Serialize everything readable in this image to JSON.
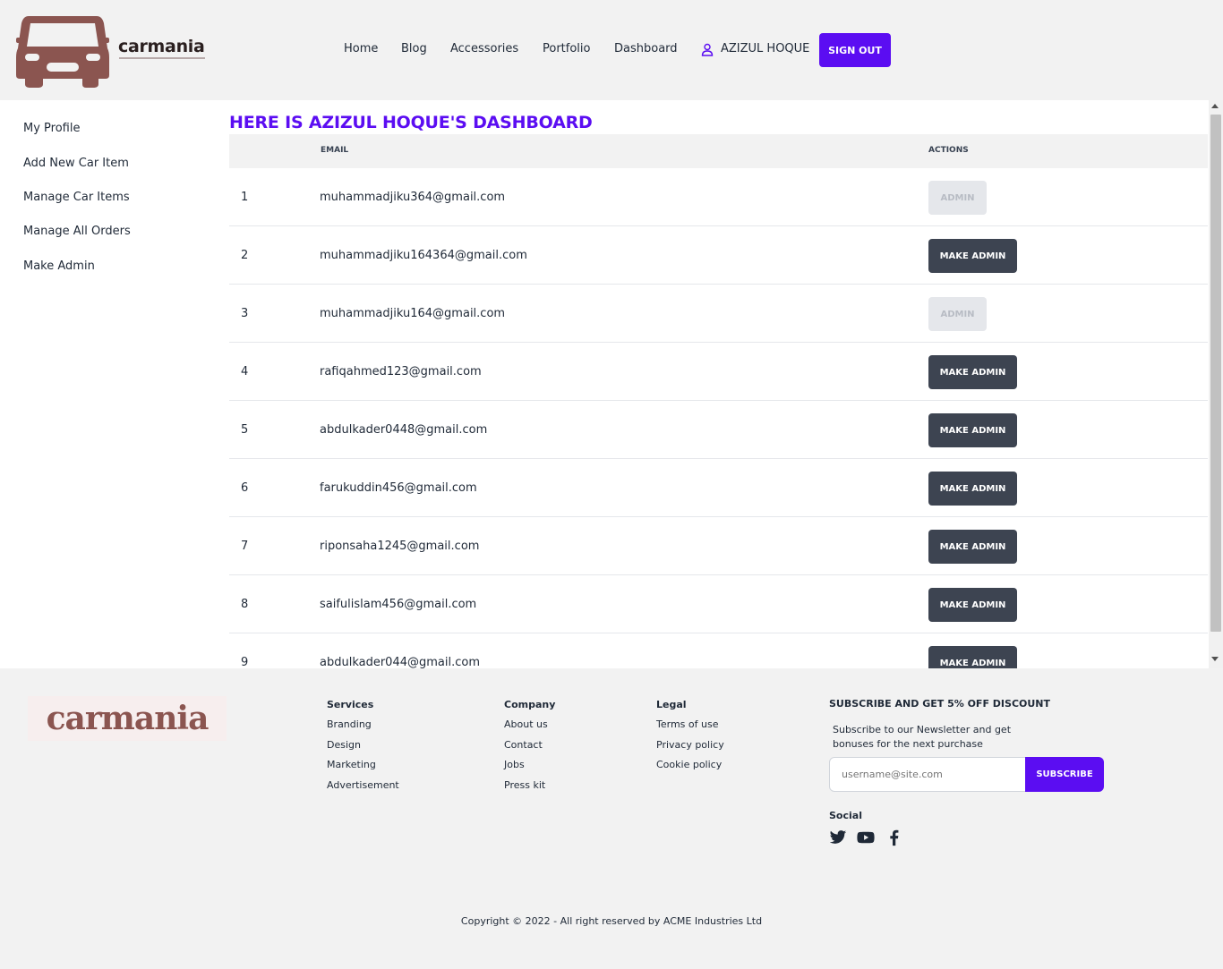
{
  "brand": {
    "name": "carmania",
    "accent": "#5b0df2",
    "logo_color": "#8b5550"
  },
  "nav": {
    "items": [
      "Home",
      "Blog",
      "Accessories",
      "Portfolio",
      "Dashboard"
    ],
    "user_name": "AZIZUL HOQUE",
    "signout_label": "SIGN OUT"
  },
  "sidebar": {
    "items": [
      "My Profile",
      "Add New Car Item",
      "Manage Car Items",
      "Manage All Orders",
      "Make Admin"
    ]
  },
  "dashboard": {
    "title": "HERE IS AZIZUL HOQUE'S DASHBOARD",
    "columns": [
      "EMAIL",
      "ACTIONS"
    ],
    "rows": [
      {
        "num": "1",
        "email": "muhammadjiku364@gmail.com",
        "action": "ADMIN",
        "is_admin": true
      },
      {
        "num": "2",
        "email": "muhammadjiku164364@gmail.com",
        "action": "MAKE ADMIN",
        "is_admin": false
      },
      {
        "num": "3",
        "email": "muhammadjiku164@gmail.com",
        "action": "ADMIN",
        "is_admin": true
      },
      {
        "num": "4",
        "email": "rafiqahmed123@gmail.com",
        "action": "MAKE ADMIN",
        "is_admin": false
      },
      {
        "num": "5",
        "email": "abdulkader0448@gmail.com",
        "action": "MAKE ADMIN",
        "is_admin": false
      },
      {
        "num": "6",
        "email": "farukuddin456@gmail.com",
        "action": "MAKE ADMIN",
        "is_admin": false
      },
      {
        "num": "7",
        "email": "riponsaha1245@gmail.com",
        "action": "MAKE ADMIN",
        "is_admin": false
      },
      {
        "num": "8",
        "email": "saifulislam456@gmail.com",
        "action": "MAKE ADMIN",
        "is_admin": false
      },
      {
        "num": "9",
        "email": "abdulkader044@gmail.com",
        "action": "MAKE ADMIN",
        "is_admin": false
      }
    ]
  },
  "footer": {
    "logo_text": "carmania",
    "services": {
      "title": "Services",
      "links": [
        "Branding",
        "Design",
        "Marketing",
        "Advertisement"
      ]
    },
    "company": {
      "title": "Company",
      "links": [
        "About us",
        "Contact",
        "Jobs",
        "Press kit"
      ]
    },
    "legal": {
      "title": "Legal",
      "links": [
        "Terms of use",
        "Privacy policy",
        "Cookie policy"
      ]
    },
    "subscribe": {
      "title": "SUBSCRIBE AND GET 5% OFF DISCOUNT",
      "text": "Subscribe to our Newsletter and get bonuses for the next purchase",
      "placeholder": "username@site.com",
      "button": "SUBSCRIBE"
    },
    "social": {
      "title": "Social",
      "icons": [
        "twitter-icon",
        "youtube-icon",
        "facebook-icon"
      ]
    },
    "copyright": "Copyright © 2022 - All right reserved by ACME Industries Ltd"
  }
}
